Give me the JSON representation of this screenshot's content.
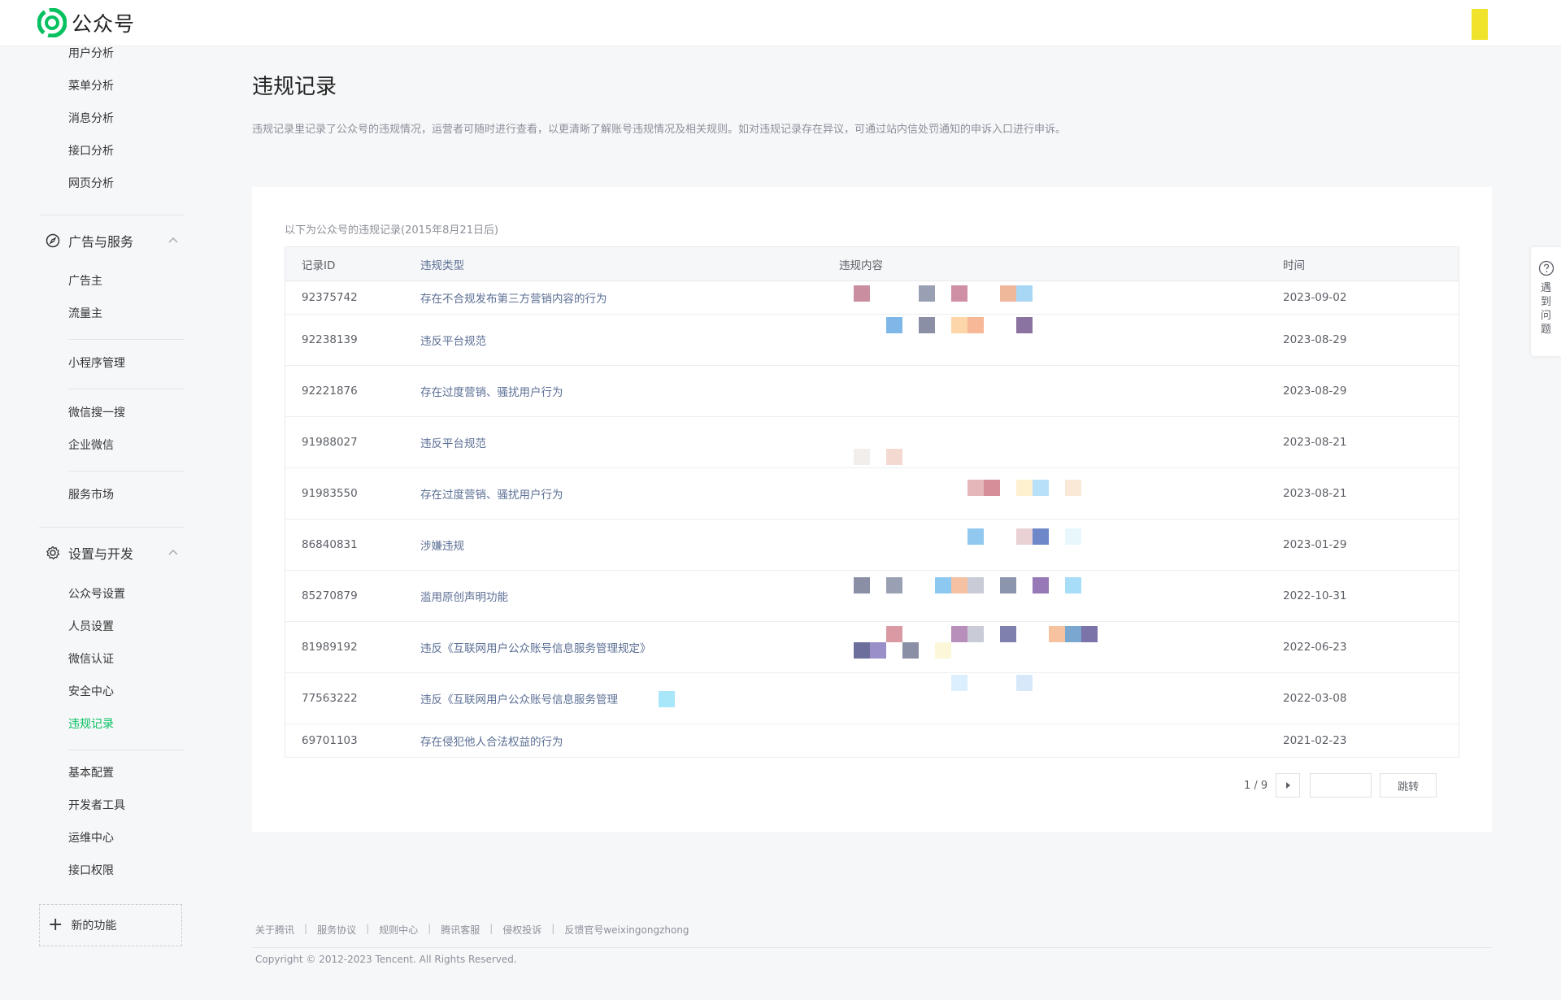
{
  "header": {
    "logo_text": "公众号"
  },
  "sidebar": {
    "analysis_items": [
      "用户分析",
      "菜单分析",
      "消息分析",
      "接口分析",
      "网页分析"
    ],
    "ad_section": {
      "title": "广告与服务"
    },
    "ad_items": [
      "广告主",
      "流量主"
    ],
    "mini_program": "小程序管理",
    "search_items": [
      "微信搜一搜",
      "企业微信"
    ],
    "service_market": "服务市场",
    "settings_section": {
      "title": "设置与开发"
    },
    "settings_items": [
      "公众号设置",
      "人员设置",
      "微信认证",
      "安全中心",
      "违规记录"
    ],
    "dev_items": [
      "基本配置",
      "开发者工具",
      "运维中心",
      "接口权限"
    ],
    "new_function": "新的功能"
  },
  "main": {
    "title": "违规记录",
    "description": "违规记录里记录了公众号的违规情况，运营者可随时进行查看，以更清晰了解账号违规情况及相关规则。如对违规记录存在异议，可通过站内信处罚通知的申诉入口进行申诉。",
    "caption": "以下为公众号的违规记录(2015年8月21日后)",
    "table": {
      "headers": [
        "记录ID",
        "违规类型",
        "违规内容",
        "时间"
      ],
      "rows": [
        {
          "id": "92375742",
          "type": "存在不合规发布第三方营销内容的行为",
          "time": "2023-09-02"
        },
        {
          "id": "92238139",
          "type": "违反平台规范",
          "time": "2023-08-29"
        },
        {
          "id": "92221876",
          "type": "存在过度营销、骚扰用户行为",
          "time": "2023-08-29"
        },
        {
          "id": "91988027",
          "type": "违反平台规范",
          "time": "2023-08-21"
        },
        {
          "id": "91983550",
          "type": "存在过度营销、骚扰用户行为",
          "time": "2023-08-21"
        },
        {
          "id": "86840831",
          "type": "涉嫌违规",
          "time": "2023-01-29"
        },
        {
          "id": "85270879",
          "type": "滥用原创声明功能",
          "time": "2022-10-31"
        },
        {
          "id": "81989192",
          "type": "违反《互联网用户公众账号信息服务管理规定》",
          "time": "2022-06-23"
        },
        {
          "id": "77563222",
          "type": "违反《互联网用户公众账号信息服务管理",
          "time": "2022-03-08"
        },
        {
          "id": "69701103",
          "type": "存在侵犯他人合法权益的行为",
          "time": "2021-02-23"
        }
      ]
    },
    "pager": {
      "text": "1 / 9",
      "jump_label": "跳转"
    }
  },
  "help": {
    "text": "遇到问题"
  },
  "footer": {
    "links": [
      "关于腾讯",
      "服务协议",
      "规则中心",
      "腾讯客服",
      "侵权投诉",
      "反馈官号weixingongzhong"
    ],
    "copyright": "Copyright © 2012-2023 Tencent. All Rights Reserved."
  },
  "colors": {
    "accent": "#07c160",
    "link": "#5d7294",
    "marker": "#f1e22b"
  },
  "icons": {
    "logo": "wechat-official-logo-icon",
    "ad_section": "compass-icon",
    "settings_section": "gear-icon",
    "chevron": "chevron-up-icon",
    "next": "triangle-right-icon",
    "help": "question-circle-icon",
    "add": "plus-icon"
  }
}
